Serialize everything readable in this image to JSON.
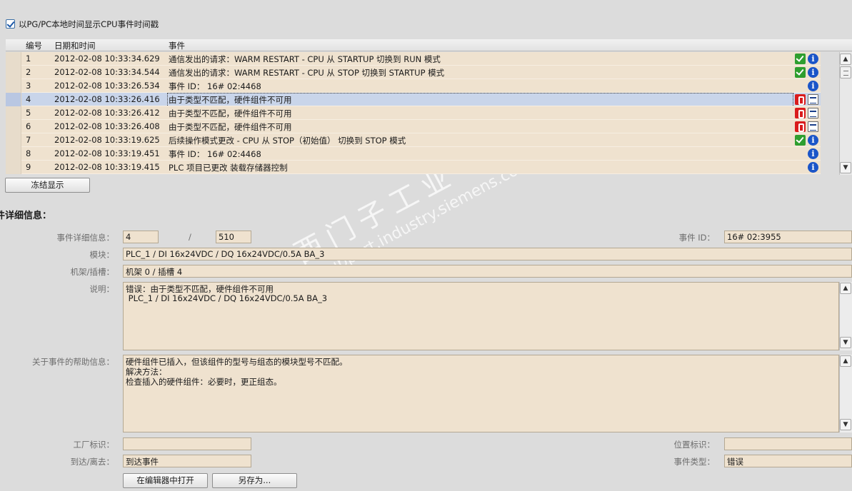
{
  "freeze_checkbox": {
    "label": "以PG/PC本地时间显示CPU事件时间戳",
    "checked": true
  },
  "table": {
    "headers": {
      "no": "编号",
      "datetime": "日期和时间",
      "event": "事件"
    },
    "rows": [
      {
        "no": "1",
        "datetime": "2012-02-08 10:33:34.629",
        "event": "通信发出的请求：WARM RESTART - CPU 从 STARTUP 切换到 RUN 模式",
        "icons": [
          "check-icon",
          "info-icon"
        ]
      },
      {
        "no": "2",
        "datetime": "2012-02-08 10:33:34.544",
        "event": "通信发出的请求：WARM RESTART - CPU 从 STOP 切换到 STARTUP 模式",
        "icons": [
          "check-icon",
          "info-icon"
        ]
      },
      {
        "no": "3",
        "datetime": "2012-02-08 10:33:26.534",
        "event": " 事件 ID： 16# 02:4468",
        "icons": [
          "info-icon"
        ]
      },
      {
        "no": "4",
        "datetime": "2012-02-08 10:33:26.416",
        "event": "由于类型不匹配，硬件组件不可用",
        "icons": [
          "error-icon",
          "acknowledge-icon"
        ],
        "selected": true
      },
      {
        "no": "5",
        "datetime": "2012-02-08 10:33:26.412",
        "event": "由于类型不匹配，硬件组件不可用",
        "icons": [
          "error-icon",
          "acknowledge-icon"
        ]
      },
      {
        "no": "6",
        "datetime": "2012-02-08 10:33:26.408",
        "event": "由于类型不匹配，硬件组件不可用",
        "icons": [
          "error-icon",
          "acknowledge-icon"
        ]
      },
      {
        "no": "7",
        "datetime": "2012-02-08 10:33:19.625",
        "event": "后续操作模式更改 - CPU 从 STOP（初始值） 切换到 STOP 模式",
        "icons": [
          "check-icon",
          "info-icon"
        ]
      },
      {
        "no": "8",
        "datetime": "2012-02-08 10:33:19.451",
        "event": " 事件 ID： 16# 02:4468",
        "icons": [
          "info-icon"
        ]
      },
      {
        "no": "9",
        "datetime": "2012-02-08 10:33:19.415",
        "event": "PLC 项目已更改 装载存储器控制",
        "icons": [
          "info-icon"
        ]
      }
    ]
  },
  "freeze_button": "冻结显示",
  "details": {
    "section_title": "件详细信息：",
    "event_detail_label": "事件详细信息：",
    "event_index": "4",
    "event_separator": "/",
    "event_total": "510",
    "event_id_label": "事件 ID：",
    "event_id": "16# 02:3955",
    "module_label": "模块：",
    "module": "PLC_1 / DI 16x24VDC / DQ 16x24VDC/0.5A BA_3",
    "rack_label": "机架/插槽：",
    "rack": "机架 0 / 插槽 4",
    "description_label": "说明：",
    "description_lines": [
      "错误：由于类型不匹配，硬件组件不可用",
      "",
      " PLC_1 / DI 16x24VDC / DQ 16x24VDC/0.5A BA_3"
    ],
    "help_label": "关于事件的帮助信息：",
    "help_lines": [
      "硬件组件已插入，但该组件的型号与组态的模块型号不匹配。",
      "解决方法：",
      "检查插入的硬件组件：必要时，更正组态。"
    ],
    "plant_label": "工厂标识：",
    "plant": "",
    "location_label": "位置标识：",
    "location": "",
    "arrival_label": "到达/离去：",
    "arrival": "到达事件",
    "event_type_label": "事件类型：",
    "event_type": "错误"
  },
  "buttons": {
    "open_editor": "在编辑器中打开",
    "save_as": "另存为..."
  },
  "watermark": {
    "line1": "西门子工业  找答案",
    "line2": "support.industry.siemens.com/cs"
  }
}
